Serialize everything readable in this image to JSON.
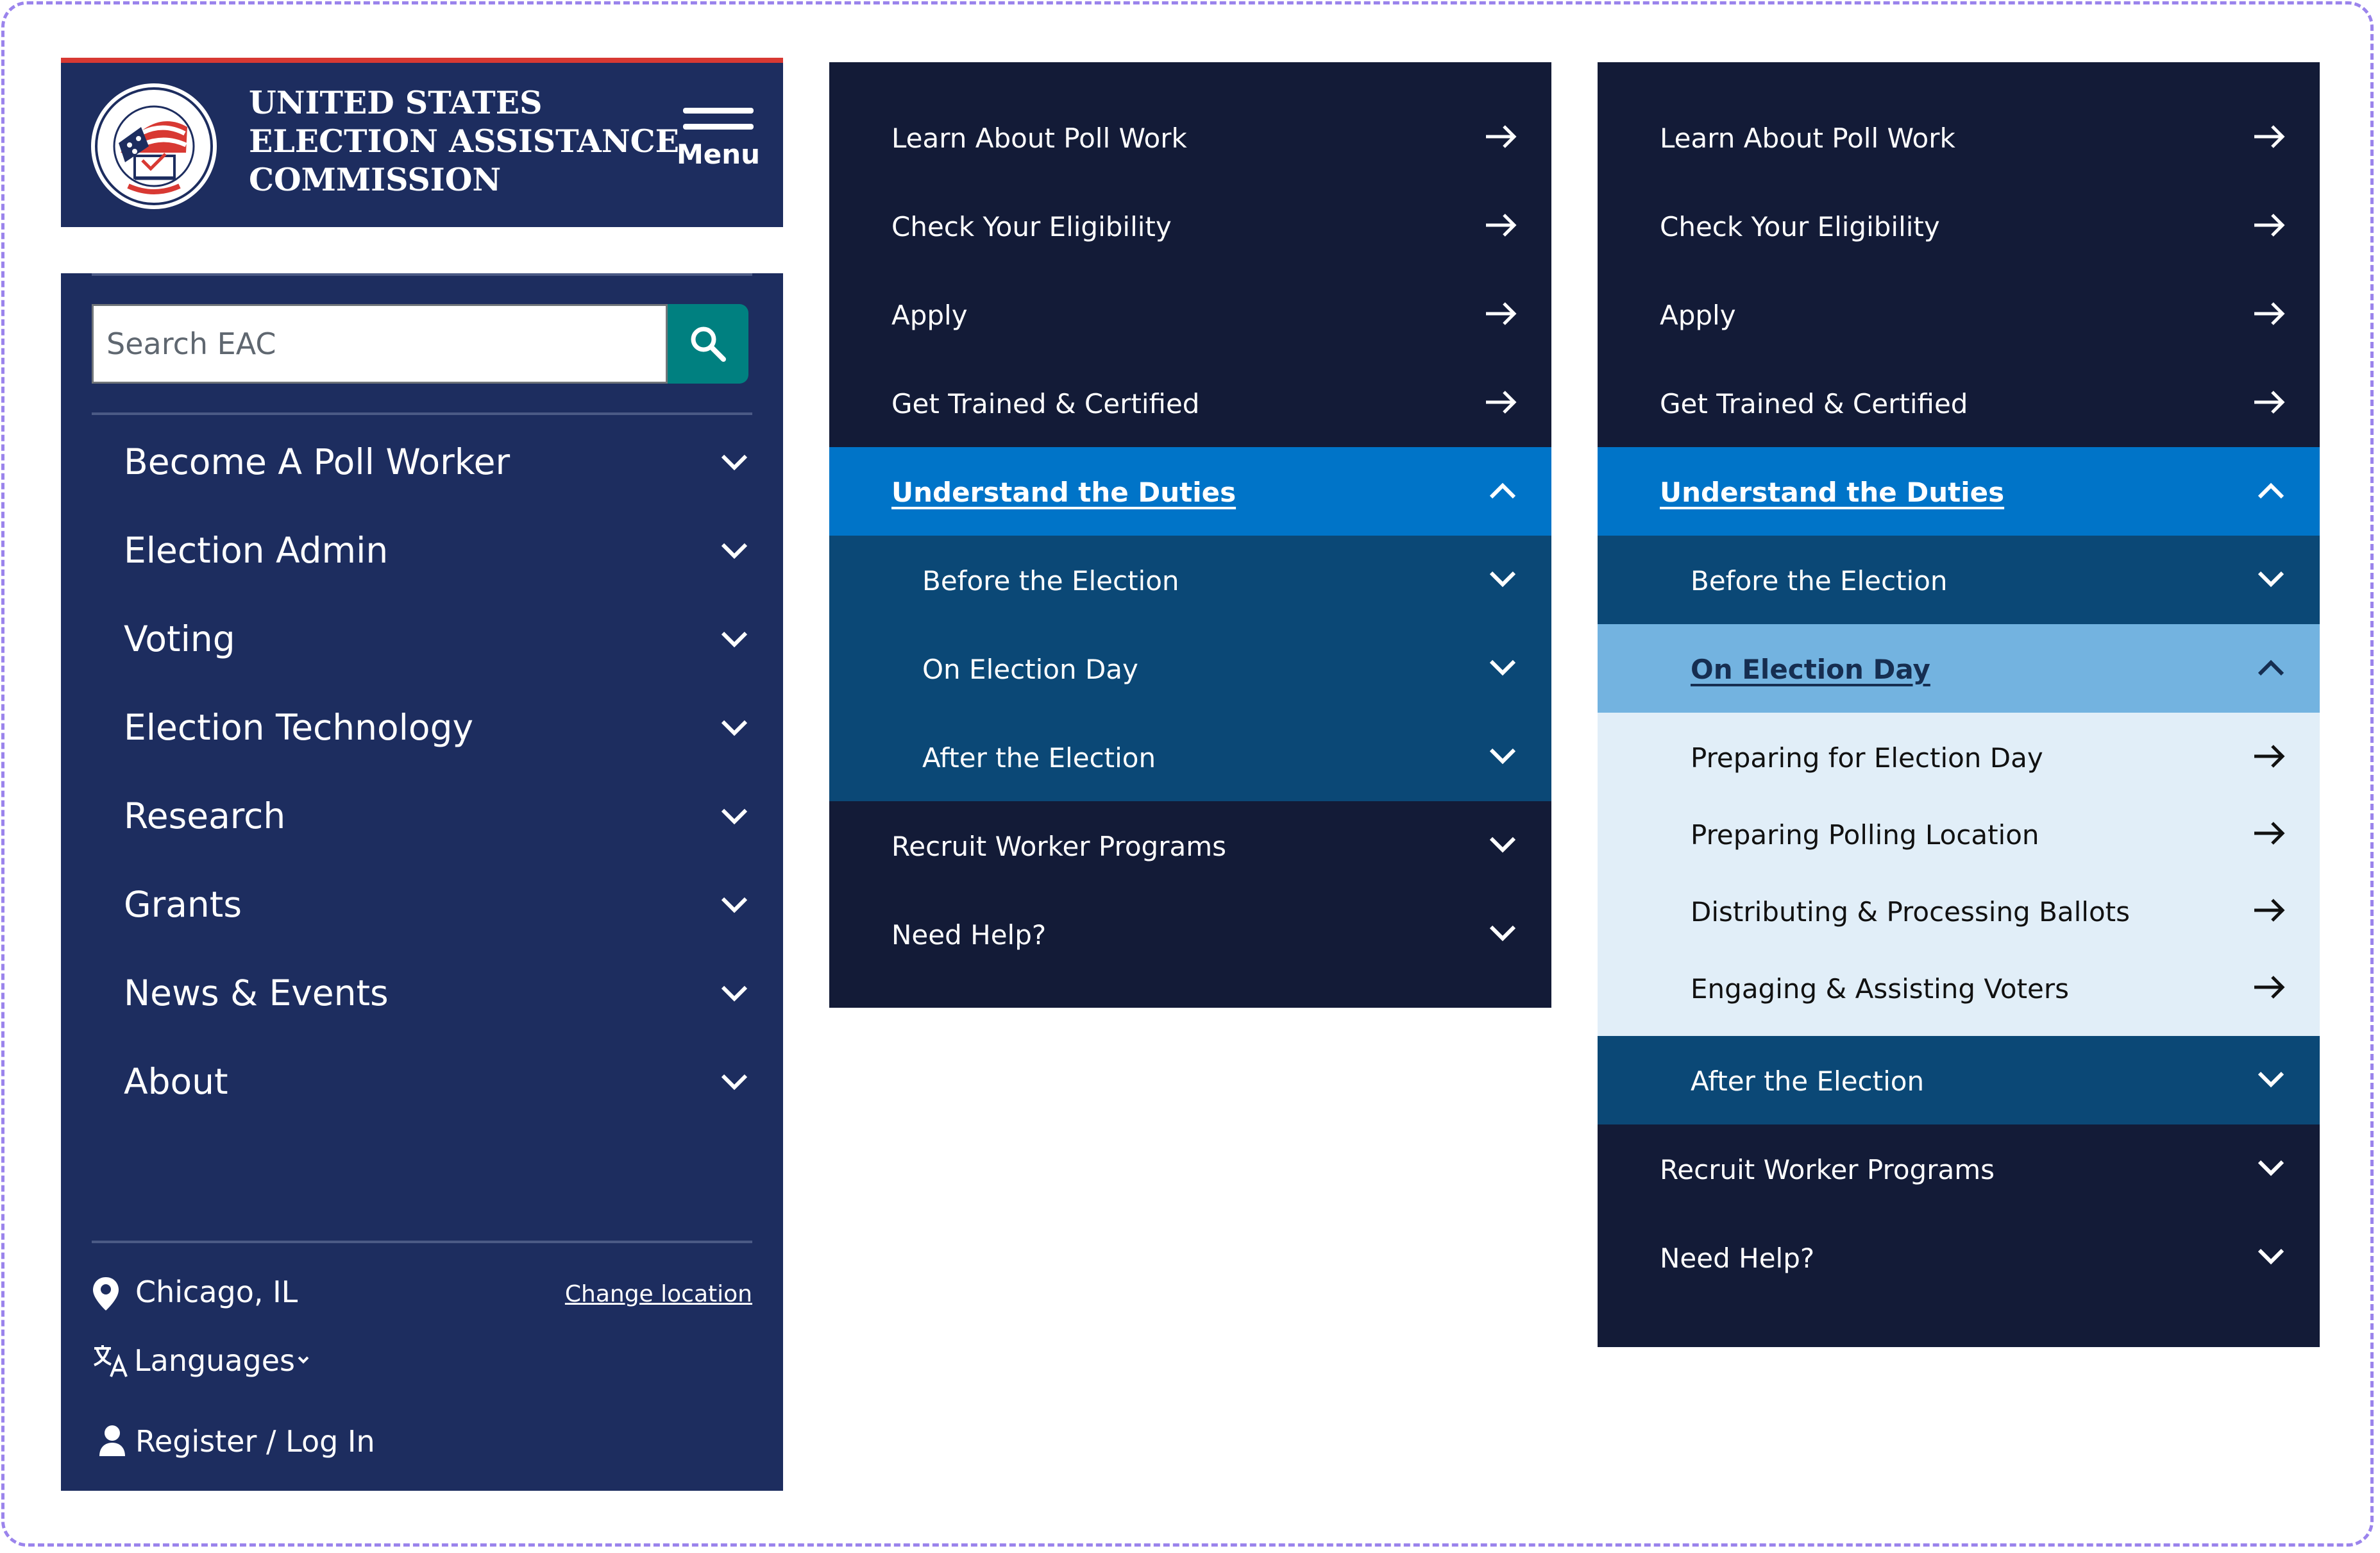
{
  "header": {
    "agency_lines": [
      "UNITED STATES",
      "ELECTION ASSISTANCE",
      "COMMISSION"
    ],
    "menu_label": "Menu",
    "accent_color": "#d83933",
    "background_color": "#1d2d5f"
  },
  "search": {
    "placeholder": "Search EAC",
    "button_icon": "search-icon",
    "button_color": "#008080"
  },
  "main_nav": [
    {
      "label": "Become A Poll Worker"
    },
    {
      "label": "Election Admin"
    },
    {
      "label": "Voting"
    },
    {
      "label": "Election Technology"
    },
    {
      "label": "Research"
    },
    {
      "label": "Grants"
    },
    {
      "label": "News & Events"
    },
    {
      "label": "About"
    }
  ],
  "location": {
    "city": "Chicago, IL",
    "change_label": "Change location"
  },
  "languages_label": "Languages",
  "login_label": "Register / Log In",
  "panel2": {
    "top_items": [
      "Learn About Poll Work",
      "Check Your Eligibility",
      "Apply",
      "Get Trained & Certified"
    ],
    "current": "Understand the Duties",
    "sub_items": [
      "Before the Election",
      "On Election Day",
      "After the Election"
    ],
    "bottom_items": [
      "Recruit Worker Programs",
      "Need Help?"
    ]
  },
  "panel3": {
    "top_items": [
      "Learn About Poll Work",
      "Check Your Eligibility",
      "Apply",
      "Get Trained & Certified"
    ],
    "current": "Understand the Duties",
    "sub_before": "Before the Election",
    "sub_open": "On Election Day",
    "leaf_items": [
      "Preparing for Election Day",
      "Preparing Polling Location",
      "Distributing & Processing Ballots",
      "Engaging & Assisting Voters"
    ],
    "sub_after": "After the Election",
    "bottom_items": [
      "Recruit Worker Programs",
      "Need Help?"
    ]
  },
  "colors": {
    "nav_dark": "#131b37",
    "current_blue": "#0074c8",
    "sub_blue": "#0b4876",
    "open_light_blue": "#73b3e0",
    "leaf_bg": "#e1eef8"
  }
}
